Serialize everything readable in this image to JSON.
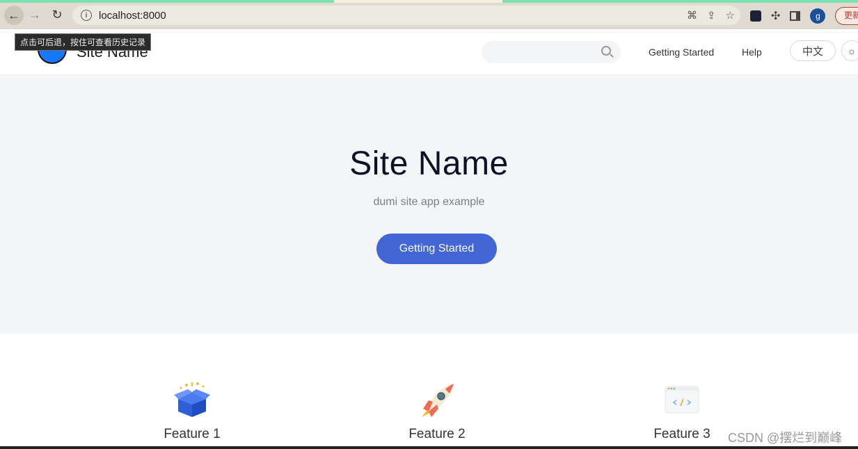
{
  "browser": {
    "url": "localhost:8000",
    "update_label": "更新",
    "avatar_letter": "g"
  },
  "tooltip": "点击可后退，按住可查看历史记录",
  "header": {
    "brand": "Site Name",
    "search_placeholder": "",
    "nav": [
      "Getting Started",
      "Help"
    ],
    "lang": "中文"
  },
  "hero": {
    "title": "Site Name",
    "description": "dumi site app example",
    "cta": "Getting Started"
  },
  "features": [
    {
      "label": "Feature 1",
      "icon": "gift-box-icon"
    },
    {
      "label": "Feature 2",
      "icon": "rocket-icon"
    },
    {
      "label": "Feature 3",
      "icon": "code-window-icon"
    }
  ],
  "watermark": "CSDN @摆烂到巅峰",
  "colors": {
    "accent": "#4266d5",
    "hero_bg": "#f4f5f7",
    "logo": "#1677ff"
  }
}
